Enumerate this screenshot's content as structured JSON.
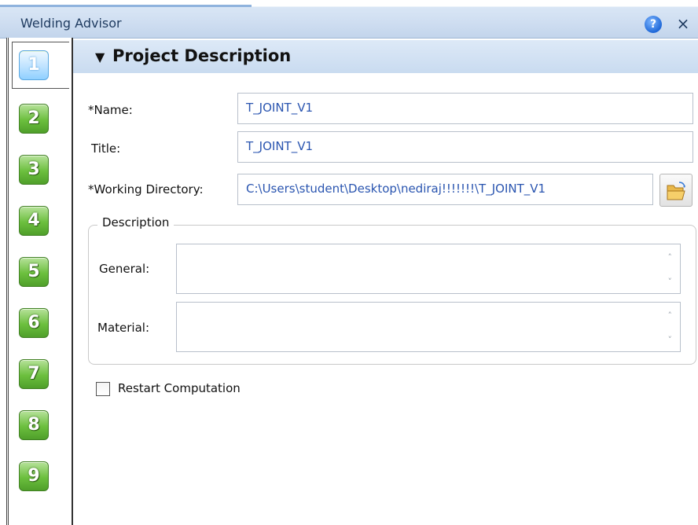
{
  "window": {
    "title": "Welding Advisor",
    "help_icon": "?",
    "close_icon": "×"
  },
  "steps": [
    {
      "label": "1",
      "active": true
    },
    {
      "label": "2",
      "active": false
    },
    {
      "label": "3",
      "active": false
    },
    {
      "label": "4",
      "active": false
    },
    {
      "label": "5",
      "active": false
    },
    {
      "label": "6",
      "active": false
    },
    {
      "label": "7",
      "active": false
    },
    {
      "label": "8",
      "active": false
    },
    {
      "label": "9",
      "active": false
    }
  ],
  "section": {
    "arrow": "▼",
    "title": "Project Description"
  },
  "form": {
    "name_label": "*Name:",
    "name_value": "T_JOINT_V1",
    "title_label": "Title:",
    "title_value": "T_JOINT_V1",
    "workdir_label": "*Working Directory:",
    "workdir_value": "C:\\Users\\student\\Desktop\\nediraj!!!!!!!\\T_JOINT_V1",
    "browse_icon": "folder-open-icon"
  },
  "description": {
    "group_title": "Description",
    "general_label": "General:",
    "general_value": "",
    "material_label": "Material:",
    "material_value": "",
    "scroll_up": "˄",
    "scroll_down": "˅"
  },
  "restart": {
    "label": "Restart Computation",
    "checked": false
  },
  "colors": {
    "accent_blue": "#c9dbf0",
    "step_green": "#6cbf3e",
    "step_active": "#bfe3ff",
    "value_text": "#2a55b0"
  }
}
